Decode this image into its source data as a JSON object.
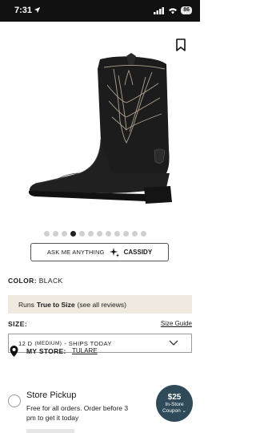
{
  "status_bar": {
    "time": "7:31",
    "battery": "86"
  },
  "product": {
    "color_label": "COLOR:",
    "color_value": "BLACK"
  },
  "gallery": {
    "dot_count": 12,
    "active_index": 3
  },
  "ask": {
    "label": "ASK ME ANYTHING",
    "name": "CASSIDY"
  },
  "fit": {
    "prefix": "Runs",
    "emphasis": "True to Size",
    "link": "(see all reviews)"
  },
  "size": {
    "label": "SIZE:",
    "guide": "Size Guide",
    "selected_size": "12 D",
    "selected_width": "(MEDIUM)",
    "selected_ship": "- SHIPS TODAY"
  },
  "store": {
    "label": "MY STORE:",
    "name": "TULARE"
  },
  "pickup": {
    "title": "Store Pickup",
    "description": "Free for all orders. Order before 3 pm to get it today"
  },
  "coupon": {
    "amount": "$25",
    "line1": "In-Store",
    "line2": "Coupon"
  },
  "colors": {
    "accent": "#2f4b5a",
    "banner": "#f0e9df",
    "boot": "#1c1c1c",
    "stitch": "#c8b9a0"
  }
}
